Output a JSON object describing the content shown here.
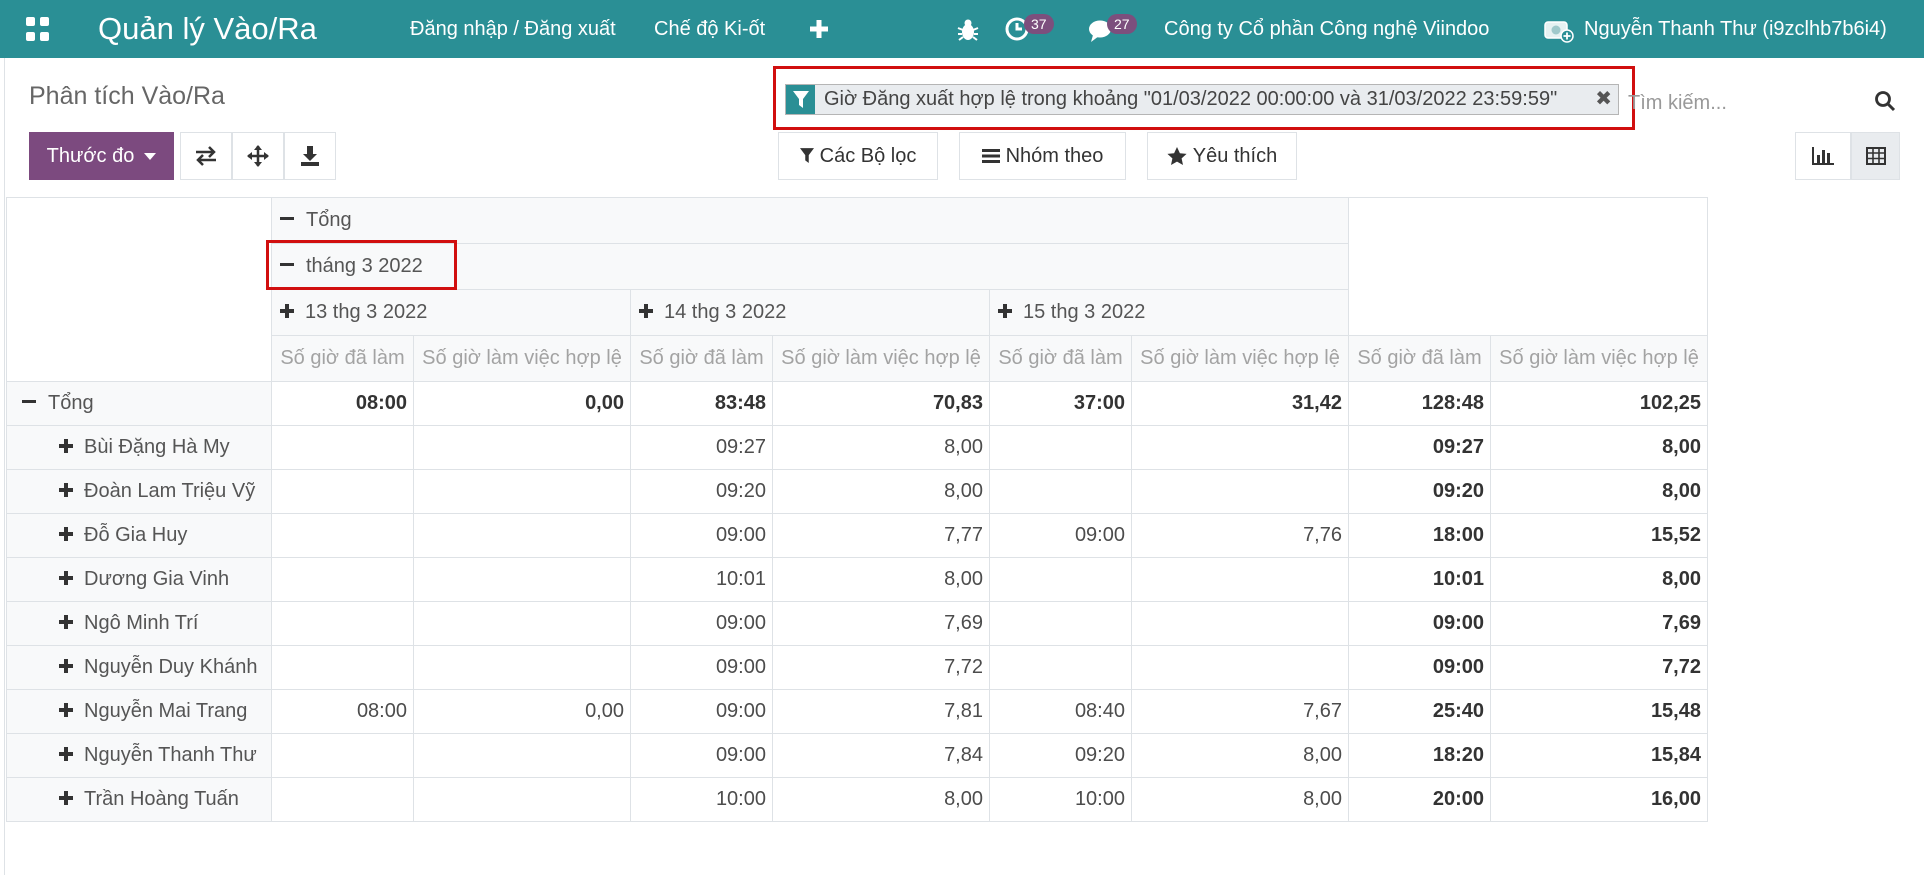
{
  "navbar": {
    "app_title": "Quản lý Vào/Ra",
    "menu": [
      "Đăng nhập / Đăng xuất",
      "Chế độ Ki-ốt"
    ],
    "plus_icon": "plus-icon",
    "activity_count": "37",
    "message_count": "27",
    "company": "Công ty Cổ phần Công nghệ Viindoo",
    "user": "Nguyễn Thanh Thư (i9zclhb7b6i4)",
    "color": "#2a8f95"
  },
  "breadcrumb": "Phân tích Vào/Ra",
  "search": {
    "facet_label": "Giờ Đăng xuất hợp lệ trong khoảng \"01/03/2022 00:00:00 và 31/03/2022 23:59:59\"",
    "placeholder": "Tìm kiếm..."
  },
  "toolbar": {
    "measures_label": "Thước đo",
    "filters_label": "Các Bộ lọc",
    "groupby_label": "Nhóm theo",
    "favorites_label": "Yêu thích",
    "accent": "#7c4a7f"
  },
  "pivot": {
    "col_total": "Tổng",
    "month": "tháng 3 2022",
    "days": [
      "13 thg 3 2022",
      "14 thg 3 2022",
      "15 thg 3 2022"
    ],
    "measures": [
      "Số giờ đã làm",
      "Số giờ làm việc hợp lệ"
    ],
    "total_row": {
      "label": "Tổng",
      "values": [
        "08:00",
        "0,00",
        "83:48",
        "70,83",
        "37:00",
        "31,42",
        "128:48",
        "102,25"
      ]
    },
    "rows": [
      {
        "label": "Bùi Đặng Hà My",
        "values": [
          "",
          "",
          "09:27",
          "8,00",
          "",
          "",
          "09:27",
          "8,00"
        ]
      },
      {
        "label": "Đoàn Lam Triệu Vỹ",
        "values": [
          "",
          "",
          "09:20",
          "8,00",
          "",
          "",
          "09:20",
          "8,00"
        ]
      },
      {
        "label": "Đỗ Gia Huy",
        "values": [
          "",
          "",
          "09:00",
          "7,77",
          "09:00",
          "7,76",
          "18:00",
          "15,52"
        ]
      },
      {
        "label": "Dương Gia Vinh",
        "values": [
          "",
          "",
          "10:01",
          "8,00",
          "",
          "",
          "10:01",
          "8,00"
        ]
      },
      {
        "label": "Ngô Minh Trí",
        "values": [
          "",
          "",
          "09:00",
          "7,69",
          "",
          "",
          "09:00",
          "7,69"
        ]
      },
      {
        "label": "Nguyễn Duy Khánh",
        "values": [
          "",
          "",
          "09:00",
          "7,72",
          "",
          "",
          "09:00",
          "7,72"
        ]
      },
      {
        "label": "Nguyễn Mai Trang",
        "values": [
          "08:00",
          "0,00",
          "09:00",
          "7,81",
          "08:40",
          "7,67",
          "25:40",
          "15,48"
        ]
      },
      {
        "label": "Nguyễn Thanh Thư",
        "values": [
          "",
          "",
          "09:00",
          "7,84",
          "09:20",
          "8,00",
          "18:20",
          "15,84"
        ]
      },
      {
        "label": "Trần Hoàng Tuấn",
        "values": [
          "",
          "",
          "10:00",
          "8,00",
          "10:00",
          "8,00",
          "20:00",
          "16,00"
        ]
      }
    ]
  }
}
